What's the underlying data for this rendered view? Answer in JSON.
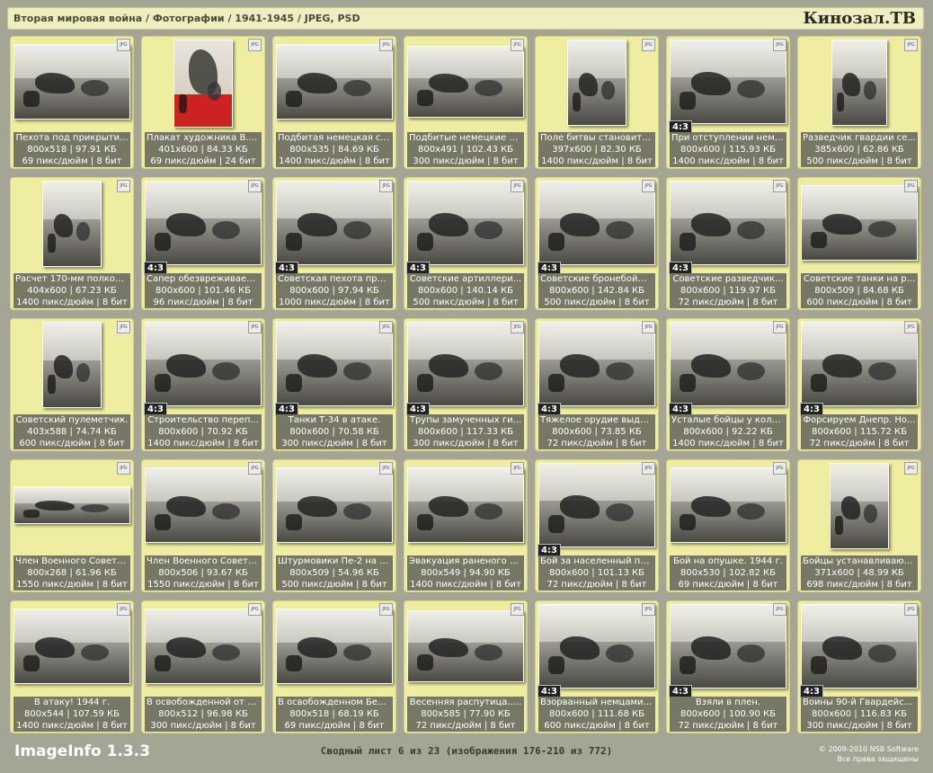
{
  "header": {
    "path": "Вторая мировая война / Фотографии / 1941-1945 / JPEG, PSD",
    "brand": "Кинозал.TB"
  },
  "badges": {
    "jpg": "JPG"
  },
  "items": [
    {
      "caption": "Пехота под прикрыти...",
      "size": "800x518 | 97.91 КБ",
      "meta": "69 пикс/дюйм | 8 бит",
      "ratio": "",
      "shape": "wide"
    },
    {
      "caption": "Плакат художника В. ...",
      "size": "401x600 | 84.33 КБ",
      "meta": "69 пикс/дюйм | 24 бит",
      "ratio": "",
      "shape": "poster"
    },
    {
      "caption": "Подбитая немецкая са...",
      "size": "800x535 | 84.69 КБ",
      "meta": "1400 пикс/дюйм | 8 бит",
      "ratio": "",
      "shape": "wide"
    },
    {
      "caption": "Подбитые немецкие с...",
      "size": "800x491 | 102.43 КБ",
      "meta": "300 пикс/дюйм | 8 бит",
      "ratio": "",
      "shape": "wide2"
    },
    {
      "caption": "Поле битвы становитс...",
      "size": "397x600 | 82.30 КБ",
      "meta": "1400 пикс/дюйм | 8 бит",
      "ratio": "",
      "shape": "tall"
    },
    {
      "caption": "При отступлении немц...",
      "size": "800x600 | 115.93 КБ",
      "meta": "1400 пикс/дюйм | 8 бит",
      "ratio": "4:3",
      "shape": "full"
    },
    {
      "caption": "Разведчик гвардии се...",
      "size": "385x600 | 62.86 КБ",
      "meta": "500 пикс/дюйм | 8 бит",
      "ratio": "",
      "shape": "tall2"
    },
    {
      "caption": "Расчет 170-мм полков...",
      "size": "404x600 | 67.23 КБ",
      "meta": "1400 пикс/дюйм | 8 бит",
      "ratio": "",
      "shape": "tall"
    },
    {
      "caption": "Сапер обезвреживает ...",
      "size": "800x600 | 101.46 КБ",
      "meta": "96 пикс/дюйм | 8 бит",
      "ratio": "4:3",
      "shape": "full"
    },
    {
      "caption": "Советская пехота при...",
      "size": "800x600 | 97.94 КБ",
      "meta": "1000 пикс/дюйм | 8 бит",
      "ratio": "4:3",
      "shape": "full"
    },
    {
      "caption": "Советские артиллери...",
      "size": "800x600 | 140.14 КБ",
      "meta": "500 пикс/дюйм | 8 бит",
      "ratio": "4:3",
      "shape": "full"
    },
    {
      "caption": "Советские бронебойщ...",
      "size": "800x600 | 142.84 КБ",
      "meta": "500 пикс/дюйм | 8 бит",
      "ratio": "4:3",
      "shape": "full"
    },
    {
      "caption": "Советские разведчик...",
      "size": "800x600 | 119.97 КБ",
      "meta": "72 пикс/дюйм | 8 бит",
      "ratio": "4:3",
      "shape": "full"
    },
    {
      "caption": "Советские танки на р...",
      "size": "800x509 | 84.68 КБ",
      "meta": "600 пикс/дюйм | 8 бит",
      "ratio": "",
      "shape": "wide"
    },
    {
      "caption": "Советский пулеметчик.",
      "size": "403x588 | 74.74 КБ",
      "meta": "600 пикс/дюйм | 8 бит",
      "ratio": "",
      "shape": "tall"
    },
    {
      "caption": "Строительство переп...",
      "size": "800x600 | 70.92 КБ",
      "meta": "1400 пикс/дюйм | 8 бит",
      "ratio": "4:3",
      "shape": "full"
    },
    {
      "caption": "Танки Т-34 в атаке.",
      "size": "800x600 | 70.58 КБ",
      "meta": "300 пикс/дюйм | 8 бит",
      "ratio": "4:3",
      "shape": "full"
    },
    {
      "caption": "Трупы замученных ги...",
      "size": "800x600 | 117.33 КБ",
      "meta": "300 пикс/дюйм | 8 бит",
      "ratio": "4:3",
      "shape": "full"
    },
    {
      "caption": "Тяжелое орудие выдв...",
      "size": "800x600 | 73.85 КБ",
      "meta": "72 пикс/дюйм | 8 бит",
      "ratio": "4:3",
      "shape": "full"
    },
    {
      "caption": "Усталые бойцы у коло...",
      "size": "800x600 | 92.22 КБ",
      "meta": "1400 пикс/дюйм | 8 бит",
      "ratio": "4:3",
      "shape": "full"
    },
    {
      "caption": "Форсируем Днепр. Но...",
      "size": "800x600 | 115.72 КБ",
      "meta": "72 пикс/дюйм | 8 бит",
      "ratio": "4:3",
      "shape": "full"
    },
    {
      "caption": "Член Военного Совета...",
      "size": "800x268 | 61.96 КБ",
      "meta": "1550 пикс/дюйм | 8 бит",
      "ratio": "",
      "shape": "pano"
    },
    {
      "caption": "Член Военного Совета...",
      "size": "800x506 | 93.67 КБ",
      "meta": "1550 пикс/дюйм | 8 бит",
      "ratio": "",
      "shape": "wide"
    },
    {
      "caption": "Штурмовики Пе-2 на б...",
      "size": "800x509 | 54.96 КБ",
      "meta": "500 пикс/дюйм | 8 бит",
      "ratio": "",
      "shape": "wide"
    },
    {
      "caption": "Эвакуация раненого б...",
      "size": "800x549 | 94.90 КБ",
      "meta": "1400 пикс/дюйм | 8 бит",
      "ratio": "",
      "shape": "wide"
    },
    {
      "caption": "Бой за населенный пу...",
      "size": "800x600 | 101.13 КБ",
      "meta": "72 пикс/дюйм | 8 бит",
      "ratio": "4:3",
      "shape": "full"
    },
    {
      "caption": "Бой на опушке.  1944 г.",
      "size": "800x530 | 102.82 КБ",
      "meta": "69 пикс/дюйм | 8 бит",
      "ratio": "",
      "shape": "wide"
    },
    {
      "caption": "Бойцы устанавливают...",
      "size": "371x600 | 48.99 КБ",
      "meta": "698 пикс/дюйм | 8 бит",
      "ratio": "",
      "shape": "tall"
    },
    {
      "caption": "В атаку! 1944 г.",
      "size": "800x544 | 107.59 КБ",
      "meta": "1400 пикс/дюйм | 8 бит",
      "ratio": "",
      "shape": "wide"
    },
    {
      "caption": "В освобожденной от н...",
      "size": "800x512 | 96.98 КБ",
      "meta": "300 пикс/дюйм | 8 бит",
      "ratio": "",
      "shape": "wide"
    },
    {
      "caption": "В освобожденном Белг...",
      "size": "800x518 | 68.19 КБ",
      "meta": "69 пикс/дюйм | 8 бит",
      "ratio": "",
      "shape": "wide"
    },
    {
      "caption": "Весенняя распутица.....",
      "size": "800x585 | 77.90 КБ",
      "meta": "72 пикс/дюйм | 8 бит",
      "ratio": "",
      "shape": "wide2"
    },
    {
      "caption": "Взорванный немцами п...",
      "size": "800x600 | 111.68 КБ",
      "meta": "600 пикс/дюйм | 8 бит",
      "ratio": "4:3",
      "shape": "full"
    },
    {
      "caption": "Взяли в плен.",
      "size": "800x600 | 100.90 КБ",
      "meta": "72 пикс/дюйм | 8 бит",
      "ratio": "4:3",
      "shape": "full"
    },
    {
      "caption": "Воины 90-й Гвардейск...",
      "size": "800x600 | 116.83 КБ",
      "meta": "300 пикс/дюйм | 8 бит",
      "ratio": "4:3",
      "shape": "full"
    }
  ],
  "footer": {
    "app": "ImageInfo 1.3.3",
    "sheet": "Сводный лист 6 из 23 (изображения 176-210 из 772)",
    "copyright_line1": "© 2009-2010 NSB Software",
    "copyright_line2": "Все права защищены"
  }
}
